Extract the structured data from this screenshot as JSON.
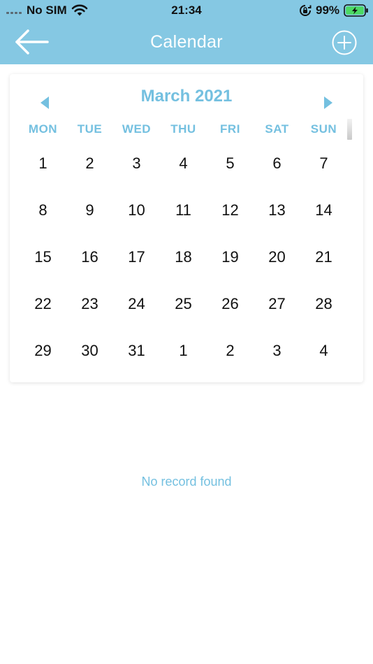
{
  "status_bar": {
    "carrier": "No SIM",
    "time": "21:34",
    "battery_percent": "99%",
    "icons": [
      "signal-dots-icon",
      "wifi-icon",
      "orientation-lock-icon",
      "battery-charging-icon"
    ]
  },
  "nav": {
    "title": "Calendar",
    "back_icon": "arrow-left-icon",
    "add_icon": "plus-circle-icon"
  },
  "calendar": {
    "month_label": "March 2021",
    "prev_icon": "triangle-left-icon",
    "next_icon": "triangle-right-icon",
    "weekdays": [
      "MON",
      "TUE",
      "WED",
      "THU",
      "FRI",
      "SAT",
      "SUN"
    ],
    "weeks": [
      [
        "1",
        "2",
        "3",
        "4",
        "5",
        "6",
        "7"
      ],
      [
        "8",
        "9",
        "10",
        "11",
        "12",
        "13",
        "14"
      ],
      [
        "15",
        "16",
        "17",
        "18",
        "19",
        "20",
        "21"
      ],
      [
        "22",
        "23",
        "24",
        "25",
        "26",
        "27",
        "28"
      ],
      [
        "29",
        "30",
        "31",
        "1",
        "2",
        "3",
        "4"
      ]
    ]
  },
  "empty_message": "No record found",
  "colors": {
    "header_bg": "#85c8e3",
    "accent": "#74c0e0",
    "day_text": "#111111",
    "background": "#ffffff"
  }
}
